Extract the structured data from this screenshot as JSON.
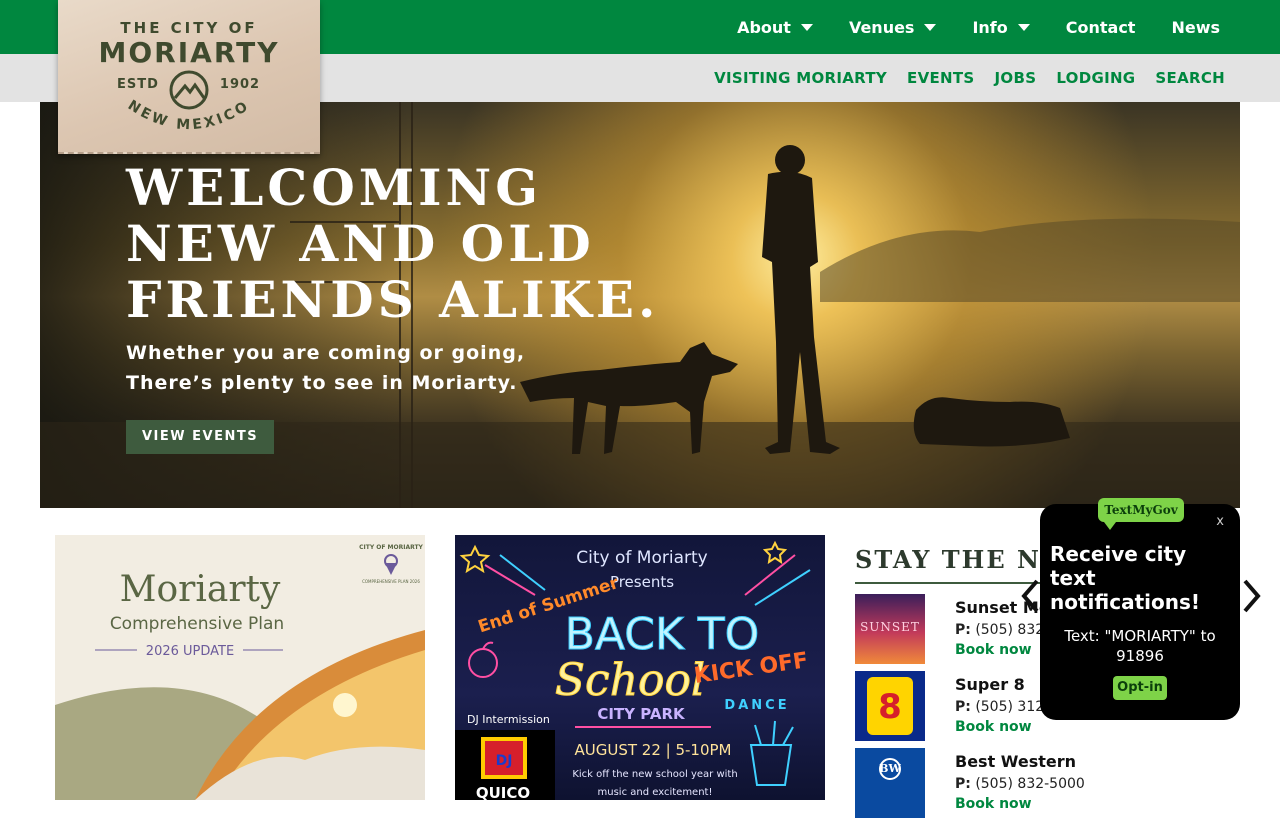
{
  "top_nav": [
    {
      "label": "About",
      "has_dropdown": true
    },
    {
      "label": "Venues",
      "has_dropdown": true
    },
    {
      "label": "Info",
      "has_dropdown": true
    },
    {
      "label": "Contact",
      "has_dropdown": false
    },
    {
      "label": "News",
      "has_dropdown": false
    }
  ],
  "sub_nav": [
    "VISITING MORIARTY",
    "EVENTS",
    "JOBS",
    "LODGING",
    "SEARCH"
  ],
  "logo": {
    "line1": "THE CITY OF",
    "line2": "MORIARTY",
    "estd": "ESTD",
    "year": "1902",
    "state": "NEW MEXICO"
  },
  "hero": {
    "title_lines": [
      "WELCOMING",
      "NEW AND OLD",
      "FRIENDS ALIKE."
    ],
    "subtitle_lines": [
      "Whether you are coming or going,",
      "There’s plenty to see in Moriarty."
    ],
    "button": "VIEW EVENTS"
  },
  "card_plan": {
    "title": "Moriarty",
    "subtitle": "Comprehensive Plan",
    "update": "2026 UPDATE",
    "badge_line1": "CITY OF MORIARTY",
    "badge_line2": "COMPREHENSIVE PLAN 2026"
  },
  "card_event": {
    "line1": "City of Moriarty",
    "line2": "Presents",
    "tag": "End of Summer",
    "title1": "BACK TO",
    "title2": "School",
    "kick": "KICK OFF",
    "dance": "DANCE",
    "place": "CITY PARK",
    "dj": "DJ Intermission",
    "dj_logo": "DJ",
    "dj_name": "QUICO",
    "date": "AUGUST 22 | 5-10PM",
    "desc1": "Kick off the new school year with",
    "desc2": "music and excitement!"
  },
  "stay": {
    "title": "STAY THE NIGHT",
    "phone_label": "P:",
    "lodges": [
      {
        "name": "Sunset Motel",
        "phone": "(505) 832-4234",
        "book": "Book now",
        "thumb_text": "SUNSET",
        "thumb_color": "#3a1e5a"
      },
      {
        "name": "Super 8",
        "phone": "(505) 312-5888",
        "book": "Book now",
        "thumb_text": "8",
        "thumb_color": "#0a2a8a"
      },
      {
        "name": "Best Western",
        "phone": "(505) 832-5000",
        "book": "Book now",
        "thumb_text": "BW",
        "thumb_color": "#0a4aa0"
      }
    ]
  },
  "popup": {
    "brand": "TextMyGov",
    "close": "x",
    "headline": "Receive city text notifications!",
    "text": "Text: \"MORIARTY\" to 91896",
    "button": "Opt-in"
  },
  "colors": {
    "brand_green": "#00873f",
    "subnav_bg": "#e3e3e3",
    "button_dark": "#3e5b3e",
    "textmygov_green": "#7ed348"
  }
}
